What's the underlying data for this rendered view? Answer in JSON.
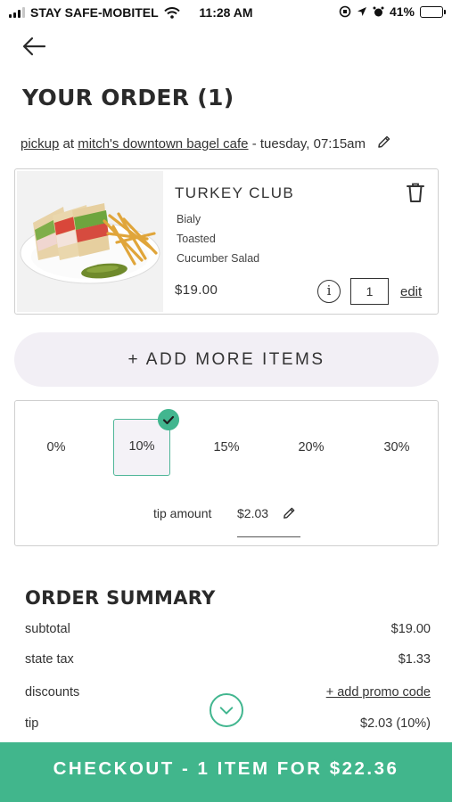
{
  "status_bar": {
    "carrier": "STAY SAFE-MOBITEL",
    "time": "11:28 AM",
    "battery": "41%",
    "battery_level": 0.41
  },
  "header": {
    "back_icon": "arrow-left-icon",
    "title": "YOUR ORDER (1)"
  },
  "order_info": {
    "mode": "pickup",
    "at": "at",
    "location": "mitch's downtown bagel cafe",
    "time": "- tuesday, 07:15am",
    "edit_icon": "pencil-icon"
  },
  "cart": {
    "items": [
      {
        "name": "TURKEY CLUB",
        "modifiers": [
          "Bialy",
          "Toasted",
          "Cucumber Salad"
        ],
        "price": "$19.00",
        "quantity": "1",
        "info_label": "i",
        "edit_label": "edit",
        "delete_icon": "trash-icon"
      }
    ]
  },
  "add_more": {
    "label": "+ ADD MORE ITEMS"
  },
  "tip": {
    "options": [
      "0%",
      "10%",
      "15%",
      "20%",
      "30%"
    ],
    "selected_index": 1,
    "amount_label": "tip amount",
    "amount_value": "$2.03",
    "accent_color": "#42b68f"
  },
  "summary": {
    "title": "ORDER SUMMARY",
    "rows": [
      {
        "label": "subtotal",
        "value": "$19.00"
      },
      {
        "label": "state tax",
        "value": "$1.33"
      },
      {
        "label": "discounts",
        "value": "+ add promo code"
      },
      {
        "label": "tip",
        "value": "$2.03 (10%)"
      }
    ]
  },
  "checkout": {
    "label": "CHECKOUT - 1 ITEM FOR $22.36",
    "color": "#41b68c"
  }
}
